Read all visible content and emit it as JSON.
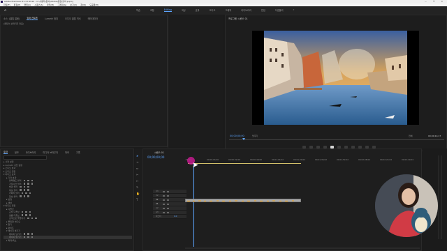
{
  "app": {
    "title": "Adobe Premiere Pro CC 2019 - C:\\사용자\\문서\\Adobe\\편집\\강의.prproj",
    "window_controls": "— ☐ ✕"
  },
  "menu": [
    "파일(F)",
    "편집(E)",
    "클립(C)",
    "시퀀스(S)",
    "마커(M)",
    "그래픽(G)",
    "보기(V)",
    "창(W)",
    "도움말(H)"
  ],
  "workspaces": [
    "학습",
    "조합",
    "Editing",
    "색상",
    "효과",
    "오디오",
    "그래픽",
    "라이브러리",
    "편집",
    "어셈블리",
    "»"
  ],
  "workspace_active": "Editing",
  "effect_controls": {
    "tabs": [
      "소스: (클립 없음)",
      "효과 컨트롤",
      "Lumetri 범위",
      "오디오 클립 믹서",
      "메타데이터"
    ],
    "active": "효과 컨트롤",
    "message": "(클립이 선택되지 않음)"
  },
  "program_monitor": {
    "title": "프로그램: 시퀀스 01",
    "timecode": "00;00;00;00",
    "fit": "맞추기",
    "quality": "전체",
    "duration": "00;00;14;17"
  },
  "project": {
    "tabs": [
      "효과",
      "정보",
      "라이브러리",
      "미디어 브라우저",
      "마커",
      "기록"
    ],
    "active": "효과",
    "search_placeholder": "검색"
  },
  "effects_tree": [
    {
      "label": "▸ 사전 설정",
      "indent": 0
    },
    {
      "label": "▸ Lumetri 사전 설정",
      "indent": 0
    },
    {
      "label": "▸ 오디오 효과",
      "indent": 0
    },
    {
      "label": "▸ 오디오 전환",
      "indent": 0
    },
    {
      "label": "▾ 비디오 효과",
      "indent": 0
    },
    {
      "label": "▸ 기타 효과",
      "indent": 1
    },
    {
      "label": "불투명도 블러",
      "indent": 2
    },
    {
      "label": "가우시안 블러",
      "indent": 2
    },
    {
      "label": "방향 블러",
      "indent": 2
    },
    {
      "label": "채널 블러",
      "indent": 2
    },
    {
      "label": "카메라 블러",
      "indent": 2
    },
    {
      "label": "합성 블러",
      "indent": 2
    },
    {
      "label": "▸ 변형",
      "indent": 1
    },
    {
      "label": "▸ 생성",
      "indent": 1
    },
    {
      "label": "▾ 비디오 전환",
      "indent": 0
    },
    {
      "label": "▸ 디졸브",
      "indent": 1
    },
    {
      "label": "교차 디졸브",
      "indent": 2
    },
    {
      "label": "필름 디졸브",
      "indent": 2
    },
    {
      "label": "흰색으로 물들이기",
      "indent": 2
    },
    {
      "label": "▸ 몰입형 비디오",
      "indent": 1
    },
    {
      "label": "▸ 밀기",
      "indent": 1
    },
    {
      "label": "▸ 와이프",
      "indent": 1
    },
    {
      "label": "▾ 페이지 벗기기",
      "indent": 1
    },
    {
      "label": "페이지 넘기기",
      "indent": 2
    },
    {
      "label": "페이지 벗기기",
      "indent": 2
    },
    {
      "label": "▸ 확대/축소",
      "indent": 1
    }
  ],
  "timeline": {
    "title": "시퀀스 01",
    "timecode": "00;00;00;00",
    "ruler": [
      ":00;00",
      "00;00;16;00",
      "00;00;32;00",
      "00;00;48;00",
      "00;01;04;02",
      "00;01;20;02",
      "00;01;36;02",
      "00;01;52;02",
      "00;02;08;04",
      "00;02;24;04",
      "00;02;40;04"
    ],
    "tracks": [
      "V3",
      "V2",
      "V1",
      "A1",
      "A2",
      "A3",
      "마스터"
    ],
    "master_value": "0.0"
  },
  "colors": {
    "accent": "#5da5ff",
    "clip": "#a9a9a9",
    "playhead": "#c61a8f",
    "panel": "#1e1e1e"
  }
}
